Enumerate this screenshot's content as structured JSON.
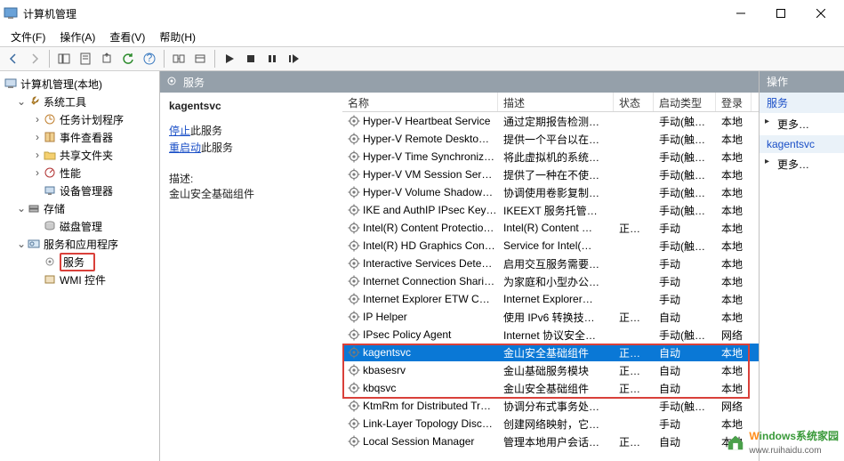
{
  "title": "计算机管理",
  "menus": {
    "file": "文件(F)",
    "action": "操作(A)",
    "view": "查看(V)",
    "help": "帮助(H)"
  },
  "tree": {
    "root": "计算机管理(本地)",
    "system_tools": "系统工具",
    "task_scheduler": "任务计划程序",
    "event_viewer": "事件查看器",
    "shared_folders": "共享文件夹",
    "performance": "性能",
    "device_manager": "设备管理器",
    "storage": "存储",
    "disk_mgmt": "磁盘管理",
    "services_apps": "服务和应用程序",
    "services": "服务",
    "wmi": "WMI 控件"
  },
  "center": {
    "header": "服务",
    "selected": "kagentsvc",
    "stop_link": "停止",
    "stop_suffix": "此服务",
    "restart_link": "重启动",
    "restart_suffix": "此服务",
    "desc_label": "描述:",
    "desc_value": "金山安全基础组件"
  },
  "columns": {
    "name": "名称",
    "desc": "描述",
    "status": "状态",
    "start": "启动类型",
    "logon": "登录"
  },
  "rows": [
    {
      "name": "Hyper-V Heartbeat Service",
      "desc": "通过定期报告检测…",
      "status": "",
      "start": "手动(触发…",
      "logon": "本地"
    },
    {
      "name": "Hyper-V Remote Deskto…",
      "desc": "提供一个平台以在…",
      "status": "",
      "start": "手动(触发…",
      "logon": "本地"
    },
    {
      "name": "Hyper-V Time Synchroniz…",
      "desc": "将此虚拟机的系统…",
      "status": "",
      "start": "手动(触发…",
      "logon": "本地"
    },
    {
      "name": "Hyper-V VM Session Ser…",
      "desc": "提供了一种在不使…",
      "status": "",
      "start": "手动(触发…",
      "logon": "本地"
    },
    {
      "name": "Hyper-V Volume Shadow…",
      "desc": "协调使用卷影复制…",
      "status": "",
      "start": "手动(触发…",
      "logon": "本地"
    },
    {
      "name": "IKE and AuthIP IPsec Key…",
      "desc": "IKEEXT 服务托管…",
      "status": "",
      "start": "手动(触发…",
      "logon": "本地"
    },
    {
      "name": "Intel(R) Content Protectio…",
      "desc": "Intel(R) Content …",
      "status": "正在…",
      "start": "手动",
      "logon": "本地"
    },
    {
      "name": "Intel(R) HD Graphics Con…",
      "desc": "Service for Intel(…",
      "status": "",
      "start": "手动(触发…",
      "logon": "本地"
    },
    {
      "name": "Interactive Services Dete…",
      "desc": "启用交互服务需要…",
      "status": "",
      "start": "手动",
      "logon": "本地"
    },
    {
      "name": "Internet Connection Shari…",
      "desc": "为家庭和小型办公…",
      "status": "",
      "start": "手动",
      "logon": "本地"
    },
    {
      "name": "Internet Explorer ETW C…",
      "desc": "Internet Explorer…",
      "status": "",
      "start": "手动",
      "logon": "本地"
    },
    {
      "name": "IP Helper",
      "desc": "使用 IPv6 转换技…",
      "status": "正在…",
      "start": "自动",
      "logon": "本地"
    },
    {
      "name": "IPsec Policy Agent",
      "desc": "Internet 协议安全…",
      "status": "",
      "start": "手动(触发…",
      "logon": "网络"
    },
    {
      "name": "kagentsvc",
      "desc": "金山安全基础组件",
      "status": "正在…",
      "start": "自动",
      "logon": "本地"
    },
    {
      "name": "kbasesrv",
      "desc": "金山基础服务模块",
      "status": "正在…",
      "start": "自动",
      "logon": "本地"
    },
    {
      "name": "kbqsvc",
      "desc": "金山安全基础组件",
      "status": "正在…",
      "start": "自动",
      "logon": "本地"
    },
    {
      "name": "KtmRm for Distributed Tr…",
      "desc": "协调分布式事务处…",
      "status": "",
      "start": "手动(触发…",
      "logon": "网络"
    },
    {
      "name": "Link-Layer Topology Disc…",
      "desc": "创建网络映射，它…",
      "status": "",
      "start": "手动",
      "logon": "本地"
    },
    {
      "name": "Local Session Manager",
      "desc": "管理本地用户会话…",
      "status": "正在…",
      "start": "自动",
      "logon": "本地"
    }
  ],
  "selected_row_index": 13,
  "actions": {
    "header": "操作",
    "services": "服务",
    "more": "更多…",
    "selected": "kagentsvc"
  },
  "watermark": {
    "text": "indows系统家园",
    "url": "www.ruihaidu.com"
  }
}
